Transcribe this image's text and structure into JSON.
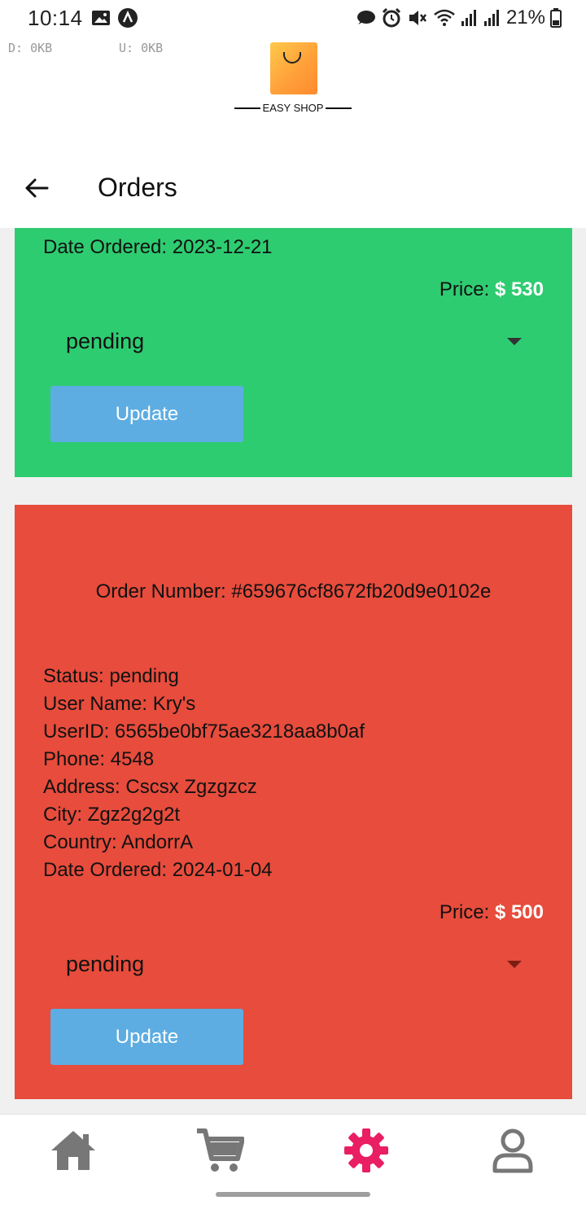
{
  "status_bar": {
    "time": "10:14",
    "battery": "21%"
  },
  "net_speed": {
    "down": "D: 0KB",
    "up": "U: 0KB"
  },
  "app": {
    "logo_text": "EASY SHOP"
  },
  "header": {
    "title": "Orders"
  },
  "orders": [
    {
      "date_ordered": "Date Ordered: 2023-12-21",
      "price_label": "Price:",
      "price_value": "$ 530",
      "status_select": "pending",
      "update_label": "Update",
      "color": "#2ecc71"
    },
    {
      "order_number": "Order Number: #659676cf8672fb20d9e0102e",
      "status": "Status: pending",
      "user_name": "User Name: Kry's",
      "user_id": "UserID: 6565be0bf75ae3218aa8b0af",
      "phone": "Phone: 4548",
      "address": "Address: Cscsx Zgzgzcz",
      "city": "City: Zgz2g2g2t",
      "country": "Country: AndorrA",
      "date_ordered": "Date Ordered: 2024-01-04",
      "price_label": "Price:",
      "price_value": "$ 500",
      "status_select": "pending",
      "update_label": "Update",
      "color": "#e74c3c"
    }
  ],
  "bottom_nav": {
    "items": [
      "home-icon",
      "cart-icon",
      "settings-icon",
      "user-icon"
    ],
    "active_color": "#e91e63",
    "inactive_color": "#777777"
  }
}
